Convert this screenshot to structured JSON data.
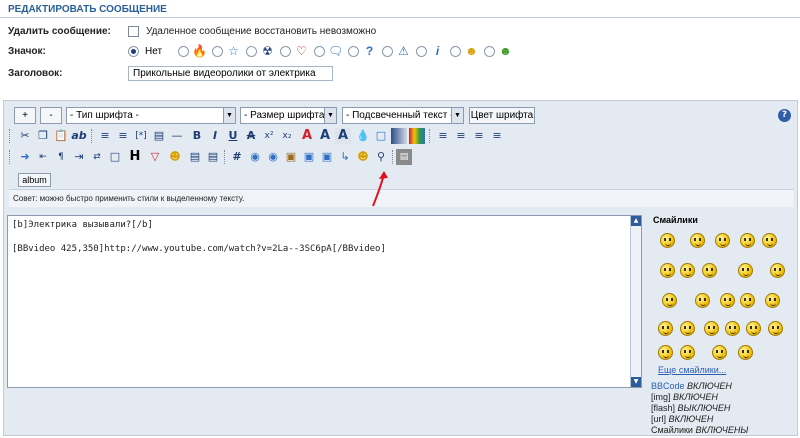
{
  "header": {
    "title": "РЕДАКТИРОВАТЬ СООБЩЕНИЕ"
  },
  "form": {
    "delete_label": "Удалить сообщение:",
    "delete_checkbox_text": "Удаленное сообщение восстановить невозможно",
    "icon_label": "Значок:",
    "icon_none_label": "Нет",
    "icon_options": [
      "flame-icon",
      "star-icon",
      "radiation-icon",
      "heart-icon",
      "speech-bubble-icon",
      "question-icon",
      "warning-icon",
      "info-icon",
      "smile-icon",
      "laugh-icon"
    ],
    "title_label": "Заголовок:",
    "title_value": "Прикольные видеоролики от электрика"
  },
  "toolbar": {
    "plus": "+",
    "minus": "-",
    "font_type": "- Тип шрифта -",
    "font_size": "- Размер шрифта -",
    "highlight": "- Подсвеченный текст -",
    "font_color": "Цвет шрифта",
    "help": "?",
    "row2_icons": [
      "cut-icon",
      "copy-icon",
      "paste-icon",
      "spellcheck-icon",
      "bullet-list-icon",
      "numbered-list-icon",
      "code-icon",
      "quote-icon",
      "hr-icon",
      "bold-icon",
      "italic-icon",
      "underline-icon",
      "strike-icon",
      "superscript-icon",
      "subscript-icon",
      "text-effect-icon",
      "text-shadow-icon",
      "text-glow-icon",
      "fill-icon",
      "gradient-icon",
      "color-grid-icon",
      "align-left-icon",
      "align-center-icon",
      "align-right-icon",
      "align-justify-icon"
    ],
    "row3_icons": [
      "insert-icon",
      "rtl-icon",
      "ltr-icon",
      "indent-icon",
      "marquee-icon",
      "box-icon",
      "header-icon",
      "warning-icon",
      "emoticon-icon",
      "spoiler-icon",
      "hash-icon",
      "web-icon",
      "image-icon",
      "flash-icon",
      "gallery-icon",
      "link-icon",
      "search-icon",
      "video-icon"
    ],
    "album": "album",
    "tip": "Совет: можно быстро применить стили к выделенному тексту."
  },
  "message": {
    "lines": [
      "[b]Электрика вызывали?[/b]",
      "",
      "[BBvideo 425,350]http://www.youtube.com/watch?v=2La--3SC6pA[/BBvideo]"
    ]
  },
  "smilies": {
    "title": "Смайлики",
    "more": "Еще смайлики..."
  },
  "status": {
    "bbcode_label": "BBCode",
    "bbcode_state": "ВКЛЮЧЕН",
    "img_label": "[img]",
    "img_state": "ВКЛЮЧЕН",
    "flash_label": "[flash]",
    "flash_state": "ВЫКЛЮЧЕН",
    "url_label": "[url]",
    "url_state": "ВКЛЮЧЕН",
    "smilies_label": "Смайлики",
    "smilies_state": "ВКЛЮЧЕНЫ"
  },
  "colors": {
    "header_text": "#2a6098",
    "panel_bg": "#e4eaf2",
    "link": "#2a5fb3",
    "arrow": "#e01020"
  }
}
